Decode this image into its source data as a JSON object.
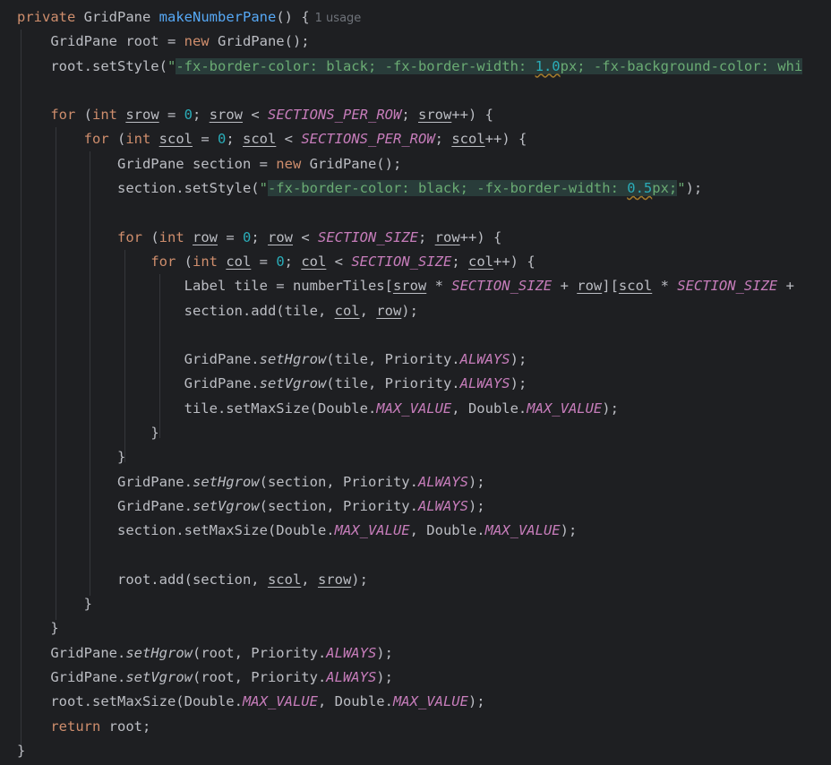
{
  "editor": {
    "usage_hint": "1 usage",
    "code": {
      "l1_private": "private",
      "l1_type": "GridPane",
      "l1_method": "makeNumberPane",
      "l1_rest": "() {",
      "l2_a": "GridPane root = ",
      "l2_new": "new",
      "l2_b": " GridPane();",
      "l3_a": "root.setStyle(",
      "l3_q": "\"",
      "l3_s1": "-fx-border-color: black; -fx-border-width: ",
      "l3_num": "1.0",
      "l3_s2": "px; -fx-background-color: whi",
      "l5_for": "for",
      "l5_a": " (",
      "l5_int": "int",
      "l5_b": " ",
      "l5_v1": "srow",
      "l5_c": " = ",
      "l5_zero": "0",
      "l5_d": "; ",
      "l5_v2": "srow",
      "l5_e": " < ",
      "l5_const": "SECTIONS_PER_ROW",
      "l5_f": "; ",
      "l5_v3": "srow",
      "l5_g": "++) {",
      "l6_for": "for",
      "l6_a": " (",
      "l6_int": "int",
      "l6_b": " ",
      "l6_v1": "scol",
      "l6_c": " = ",
      "l6_zero": "0",
      "l6_d": "; ",
      "l6_v2": "scol",
      "l6_e": " < ",
      "l6_const": "SECTIONS_PER_ROW",
      "l6_f": "; ",
      "l6_v3": "scol",
      "l6_g": "++) {",
      "l7_a": "GridPane section = ",
      "l7_new": "new",
      "l7_b": " GridPane();",
      "l8_a": "section.setStyle(",
      "l8_q1": "\"",
      "l8_s1": "-fx-border-color: black; -fx-border-width: ",
      "l8_num": "0.5",
      "l8_s2": "px;",
      "l8_q2": "\"",
      "l8_b": ");",
      "l10_for": "for",
      "l10_a": " (",
      "l10_int": "int",
      "l10_b": " ",
      "l10_v1": "row",
      "l10_c": " = ",
      "l10_zero": "0",
      "l10_d": "; ",
      "l10_v2": "row",
      "l10_e": " < ",
      "l10_const": "SECTION_SIZE",
      "l10_f": "; ",
      "l10_v3": "row",
      "l10_g": "++) {",
      "l11_for": "for",
      "l11_a": " (",
      "l11_int": "int",
      "l11_b": " ",
      "l11_v1": "col",
      "l11_c": " = ",
      "l11_zero": "0",
      "l11_d": "; ",
      "l11_v2": "col",
      "l11_e": " < ",
      "l11_const": "SECTION_SIZE",
      "l11_f": "; ",
      "l11_v3": "col",
      "l11_g": "++) {",
      "l12_a": "Label tile = numberTiles[",
      "l12_v1": "srow",
      "l12_b": " * ",
      "l12_c1": "SECTION_SIZE",
      "l12_c": " + ",
      "l12_v2": "row",
      "l12_d": "][",
      "l12_v3": "scol",
      "l12_e": " * ",
      "l12_c2": "SECTION_SIZE",
      "l12_f": " +",
      "l13_a": "section.add(tile, ",
      "l13_v1": "col",
      "l13_b": ", ",
      "l13_v2": "row",
      "l13_c": ");",
      "l15_a": "GridPane.",
      "l15_m": "setHgrow",
      "l15_b": "(tile, Priority.",
      "l15_k": "ALWAYS",
      "l15_c": ");",
      "l16_a": "GridPane.",
      "l16_m": "setVgrow",
      "l16_b": "(tile, Priority.",
      "l16_k": "ALWAYS",
      "l16_c": ");",
      "l17_a": "tile.setMaxSize(Double.",
      "l17_k1": "MAX_VALUE",
      "l17_b": ", Double.",
      "l17_k2": "MAX_VALUE",
      "l17_c": ");",
      "l18": "}",
      "l19": "}",
      "l20_a": "GridPane.",
      "l20_m": "setHgrow",
      "l20_b": "(section, Priority.",
      "l20_k": "ALWAYS",
      "l20_c": ");",
      "l21_a": "GridPane.",
      "l21_m": "setVgrow",
      "l21_b": "(section, Priority.",
      "l21_k": "ALWAYS",
      "l21_c": ");",
      "l22_a": "section.setMaxSize(Double.",
      "l22_k1": "MAX_VALUE",
      "l22_b": ", Double.",
      "l22_k2": "MAX_VALUE",
      "l22_c": ");",
      "l24_a": "root.add(section, ",
      "l24_v1": "scol",
      "l24_b": ", ",
      "l24_v2": "srow",
      "l24_c": ");",
      "l25": "}",
      "l26": "}",
      "l27_a": "GridPane.",
      "l27_m": "setHgrow",
      "l27_b": "(root, Priority.",
      "l27_k": "ALWAYS",
      "l27_c": ");",
      "l28_a": "GridPane.",
      "l28_m": "setVgrow",
      "l28_b": "(root, Priority.",
      "l28_k": "ALWAYS",
      "l28_c": ");",
      "l29_a": "root.setMaxSize(Double.",
      "l29_k1": "MAX_VALUE",
      "l29_b": ", Double.",
      "l29_k2": "MAX_VALUE",
      "l29_c": ");",
      "l30_return": "return",
      "l30_b": " root;",
      "l31": "}"
    },
    "colors": {
      "background": "#1e1f22",
      "keyword": "#cf8e6d",
      "method": "#56a8f5",
      "string": "#6aab73",
      "number": "#2aacb8",
      "constant": "#c77dbb",
      "text": "#bcbec4"
    }
  }
}
